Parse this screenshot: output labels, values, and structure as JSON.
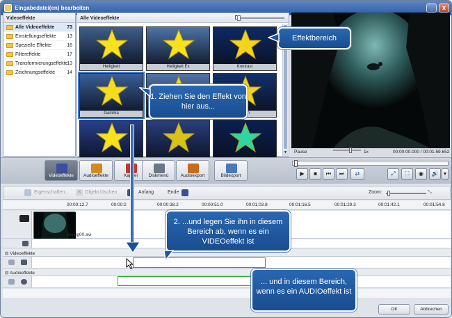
{
  "window": {
    "title": "Eingabedatei(en) bearbeiten",
    "minimize": "_",
    "close": "x"
  },
  "left_panel": {
    "header": "Videoeffekte",
    "items": [
      {
        "label": "Alle Videoeffekte",
        "count": "73"
      },
      {
        "label": "Einstellungseffekte",
        "count": "13"
      },
      {
        "label": "Spezielle Effekte",
        "count": "16"
      },
      {
        "label": "Filtereffekte",
        "count": "17"
      },
      {
        "label": "Transformierungseffekte",
        "count": "13"
      },
      {
        "label": "Zeichnungseffekte",
        "count": "14"
      }
    ]
  },
  "grid_panel": {
    "header": "Alle Videoeffekte",
    "tiles": [
      {
        "label": "Helligkeit",
        "bg": "#3f5f8a",
        "star": "#f7e21c"
      },
      {
        "label": "Helligkeit Ex",
        "bg": "#4d74a6",
        "star": "#f7e21c"
      },
      {
        "label": "Kontrast",
        "bg": "#0d2a66",
        "star": "#f4d31a"
      },
      {
        "label": "Gamma",
        "bg": "#3a5f96",
        "star": "#f6dd1c"
      },
      {
        "label": "",
        "bg": "#5275a8",
        "star": "#f3dc20"
      },
      {
        "label": "...sch",
        "bg": "#13306a",
        "star": "#f4d21a"
      },
      {
        "label": "",
        "bg": "#27408a",
        "star": "#f7e21c"
      },
      {
        "label": "",
        "bg": "#2a3f7c",
        "star": "#d8c21a"
      },
      {
        "label": "",
        "bg": "#0a2050",
        "star": "#2fd6a0"
      }
    ]
  },
  "player": {
    "status": "Pause",
    "speed": "1x",
    "time": "00:00:00.000 / 00:01:59.652"
  },
  "toolbar": {
    "buttons": [
      "Videoeffekte",
      "Audioeffekte",
      "Kapitel",
      "Diskmenü",
      "Audioexport",
      "Bildexport"
    ]
  },
  "timeline_toolbar": {
    "properties": "Eigenschaften...",
    "delete": "Objekt löschen",
    "start": "Anfang",
    "end": "Ende",
    "zoom": "Zoom:"
  },
  "ruler": [
    "00:00:12.7",
    "00:00:2",
    "00:00:38.2",
    "00:00:51.0",
    "00:01:03.8",
    "00:01:16.5",
    "00:01:29.3",
    "00:01:42.1",
    "00:01:54.8"
  ],
  "tracks": {
    "clip_name": "Diving00.avi",
    "video_effects": "Videoeffekte",
    "audio_effects": "Audioeffekte"
  },
  "callouts": {
    "effects_area": "Effektbereich",
    "drag_from": "1. Ziehen Sie den Effekt von hier aus...",
    "drop_video": "2. ...und legen Sie ihn in diesem Bereich ab, wenn es ein VIDEOeffekt ist",
    "drop_audio": "... und in diesem Bereich, wenn es ein AUDIOeffekt ist"
  },
  "footer": {
    "ok": "OK",
    "cancel": "Abbrechen"
  }
}
